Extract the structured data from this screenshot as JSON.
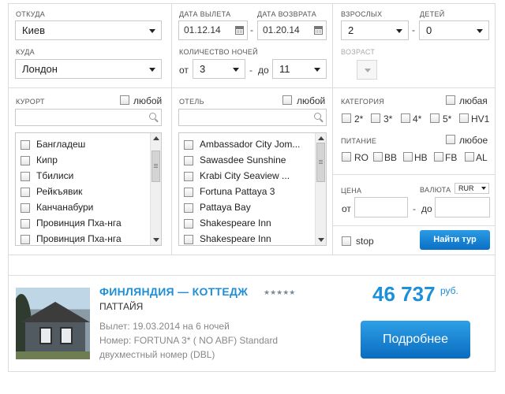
{
  "search": {
    "from_label": "ОТКУДА",
    "from_value": "Киев",
    "to_label": "КУДА",
    "to_value": "Лондон",
    "depart_label": "ДАТА ВЫЛЕТА",
    "depart_value": "01.12.14",
    "return_label": "ДАТА ВОЗВРАТА",
    "return_value": "01.20.14",
    "nights_label": "КОЛИЧЕСТВО НОЧЕЙ",
    "nights_from_prefix": "от",
    "nights_from": "3",
    "nights_to_prefix": "до",
    "nights_to": "11",
    "dash": "-",
    "adults_label": "ВЗРОСЛЫХ",
    "adults_value": "2",
    "children_label": "ДЕТЕЙ",
    "children_value": "0",
    "age_label": "ВОЗРАСТ"
  },
  "resort": {
    "label": "КУРОРТ",
    "any_label": "любой",
    "items": [
      "Бангладеш",
      "Кипр",
      "Тбилиси",
      "Рейкъявик",
      "Канчанабури",
      "Провинция Пха-нга",
      "Провинция Пха-нга"
    ]
  },
  "hotel": {
    "label": "ОТЕЛЬ",
    "any_label": "любой",
    "items": [
      "Ambassador City Jom...",
      "Sawasdee Sunshine",
      "Krabi City Seaview ...",
      "Fortuna Pattaya 3",
      "Pattaya Bay",
      "Shakespeare Inn",
      "Shakespeare Inn"
    ]
  },
  "category": {
    "label": "КАТЕГОРИЯ",
    "any_label": "любая",
    "options": [
      "2*",
      "3*",
      "4*",
      "5*",
      "HV1"
    ]
  },
  "meal": {
    "label": "ПИТАНИЕ",
    "any_label": "любое",
    "options": [
      "RO",
      "BB",
      "HB",
      "FB",
      "AL"
    ]
  },
  "price": {
    "label": "ЦЕНА",
    "from_prefix": "от",
    "to_prefix": "до",
    "currency_label": "ВАЛЮТА",
    "currency_value": "RUR"
  },
  "stop_label": "stop",
  "find_button": "Найти тур",
  "result": {
    "title": "ФИНЛЯНДИЯ — КОТТЕДЖ",
    "stars": "★★★★★",
    "city": "ПАТТАЙЯ",
    "line1": "Вылет: 19.03.2014 на 6 ночей",
    "line2": "Номер: FORTUNA 3* ( NO ABF) Standard",
    "line3": "двухместный номер (DBL)",
    "price": "46 737",
    "currency": "руб.",
    "more_button": "Подробнее"
  },
  "colors": {
    "accent": "#1e8fd9",
    "button": "#0a6fc4",
    "border": "#dcdcdc"
  }
}
